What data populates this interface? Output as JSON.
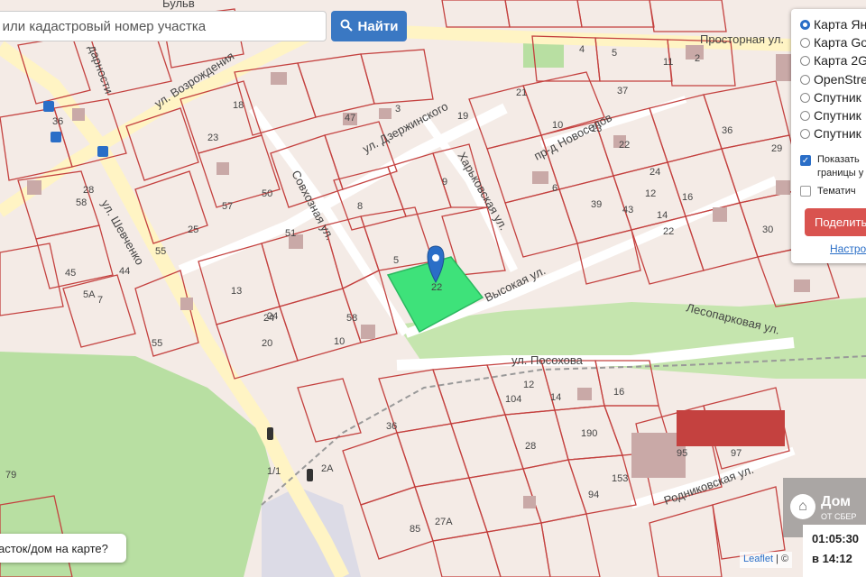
{
  "search": {
    "placeholder_text": "с или кадастровый номер участка",
    "button_label": "Найти",
    "button_icon": "search-icon"
  },
  "layers": {
    "base": [
      {
        "label": "Карта Ян",
        "selected": true
      },
      {
        "label": "Карта Go",
        "selected": false
      },
      {
        "label": "Карта 2G",
        "selected": false
      },
      {
        "label": "OpenStre",
        "selected": false
      },
      {
        "label": "Спутник",
        "selected": false
      },
      {
        "label": "Спутник",
        "selected": false
      },
      {
        "label": "Спутник",
        "selected": false
      }
    ],
    "show_boundaries_line1": "Показать",
    "show_boundaries_line2": "границы у",
    "show_boundaries_checked": true,
    "thematic_label": "Тематич",
    "thematic_checked": false,
    "share_label": "Поделить",
    "settings_link": "Настро"
  },
  "streets": [
    {
      "name": "Просторная ул."
    },
    {
      "name": "ул. Возрождения"
    },
    {
      "name": "ул. Дзержинского"
    },
    {
      "name": "Совхозная ул."
    },
    {
      "name": "Харьковская ул."
    },
    {
      "name": "пр-д Новоселов"
    },
    {
      "name": "Высокая ул."
    },
    {
      "name": "Лесопарковая ул."
    },
    {
      "name": "ул. Посохова"
    },
    {
      "name": "ул. Шевченко"
    },
    {
      "name": "Родниковская ул."
    },
    {
      "name": "Бульв"
    },
    {
      "name": "дарности"
    }
  ],
  "parcel_numbers": [
    "4",
    "5",
    "11",
    "2",
    "37",
    "21",
    "19",
    "13",
    "10",
    "22",
    "6",
    "47",
    "3",
    "23",
    "9",
    "39",
    "43",
    "36",
    "29",
    "24",
    "12",
    "14",
    "16",
    "30",
    "22",
    "8",
    "18",
    "25",
    "28",
    "50",
    "36",
    "58",
    "57",
    "44",
    "13",
    "20",
    "5",
    "10",
    "24",
    "2A",
    "5A",
    "45",
    "7",
    "55",
    "79",
    "1/1",
    "55",
    "36",
    "153",
    "94",
    "27A",
    "85",
    "97",
    "28",
    "190",
    "95",
    "104",
    "12",
    "14",
    "16",
    "58",
    "24",
    "51"
  ],
  "selected_parcel_label": "22",
  "colors": {
    "parcel_border": "#c4413f",
    "selected_parcel": "#3ee27a",
    "park": "#b8dfa2",
    "road": "#fff7cf",
    "marker": "#2a6ec7",
    "share_button": "#d9534f"
  },
  "help_bubble": "асток/дом на карте?",
  "attribution": {
    "leaflet": "Leaflet",
    "rest": "| ©"
  },
  "logo": {
    "name": "Дом",
    "subtitle": "ОТ СБЕР"
  },
  "timer": {
    "time": "01:05:30",
    "at": "в 14:12"
  }
}
